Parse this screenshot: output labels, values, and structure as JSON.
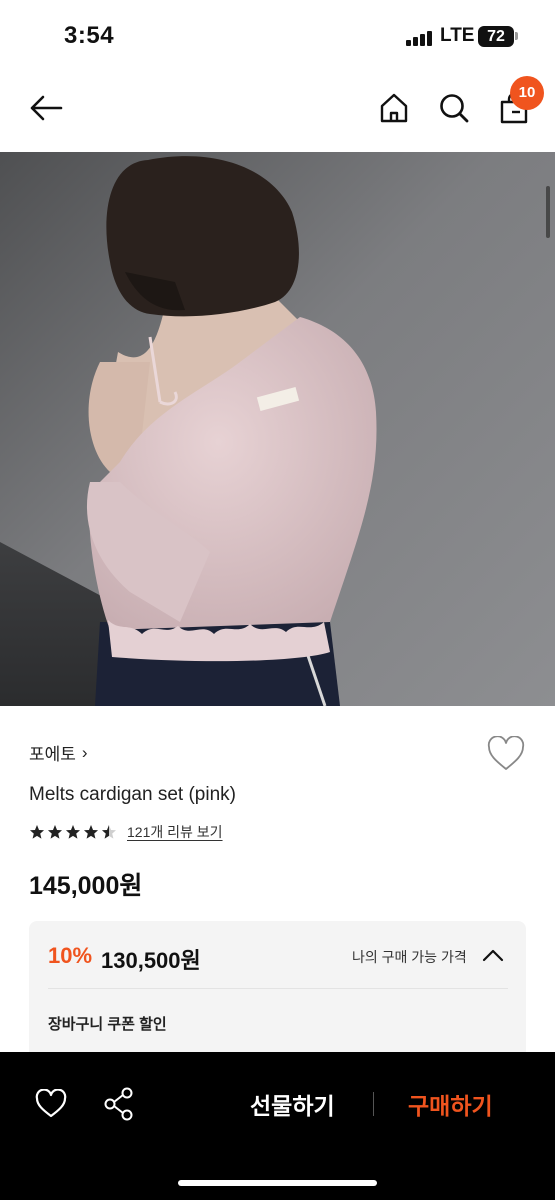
{
  "status_bar": {
    "time": "3:54",
    "network": "LTE",
    "battery": "72"
  },
  "nav": {
    "back_icon": "arrow-left-icon",
    "home_icon": "home-icon",
    "search_icon": "search-icon",
    "cart_icon": "shopping-bag-icon",
    "cart_count": "10"
  },
  "product": {
    "brand": "포에토",
    "brand_chevron": "›",
    "title": "Melts cardigan set (pink)",
    "rating": 4.5,
    "review_link": "121개 리뷰 보기",
    "price": "145,000원",
    "discount": {
      "percent": "10%",
      "price": "130,500원",
      "my_price_label": "나의 구매 가능 가격",
      "coupon_label": "장바구니 쿠폰 할인"
    }
  },
  "bottom_bar": {
    "gift_label": "선물하기",
    "buy_label": "구매하기"
  },
  "colors": {
    "accent": "#f0541e",
    "bottom_bar": "#000000",
    "box_bg": "#f4f4f4"
  }
}
